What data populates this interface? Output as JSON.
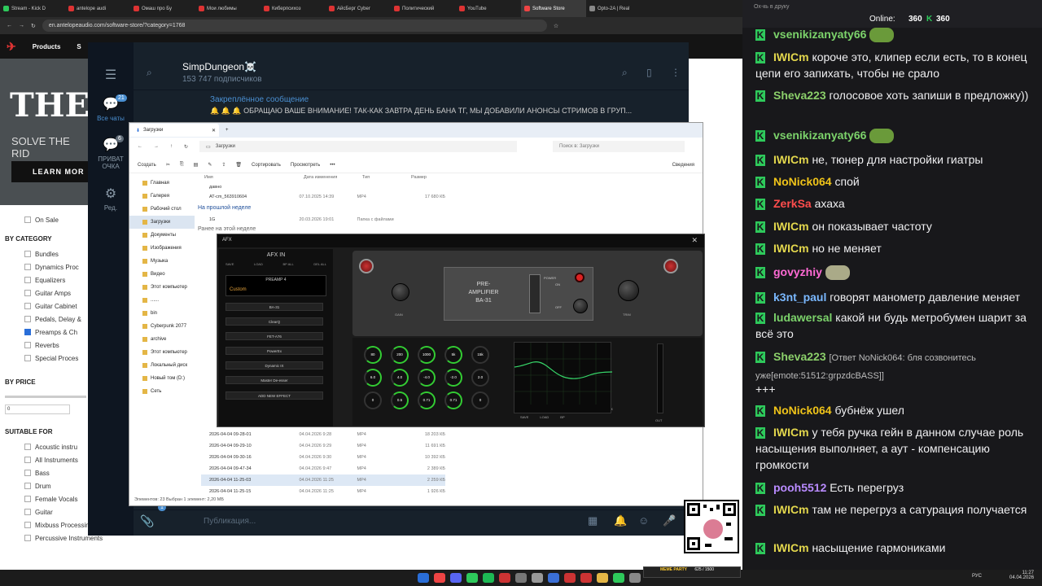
{
  "browser": {
    "tabs": [
      "Stream - Kick D",
      "antelope audi",
      "Омаш про Бу",
      "Мои любимы",
      "Киберпсихоз",
      "АйсБерг Cyber",
      "Политический",
      "YouTube",
      "Software Store",
      "Opto-2A | Real"
    ],
    "url": "en.antelopeaudio.com/software-store/?category=1768",
    "site_nav": [
      "Products",
      "S"
    ],
    "hero_title": "THE",
    "hero_sub": "SOLVE THE RID",
    "hero_btn": "LEARN MOR",
    "filters": {
      "on_sale": "On Sale",
      "by_category": "BY CATEGORY",
      "categories": [
        "Bundles",
        "Dynamics Proc",
        "Equalizers",
        "Guitar Amps",
        "Guitar Cabinet",
        "Pedals, Delay &",
        "Preamps & Ch",
        "Reverbs",
        "Special Proces"
      ],
      "checked_category": "Preamps & Ch",
      "by_price": "BY PRICE",
      "price_min": "0",
      "suitable_for": "SUITABLE FOR",
      "suitable": [
        "Acoustic instru",
        "All Instruments",
        "Bass",
        "Drum",
        "Female Vocals",
        "Guitar",
        "Mixbuss Processing",
        "Percussive Instruments"
      ]
    }
  },
  "telegram": {
    "channel": "SimpDungeon☠️",
    "subscribers": "153 747 подписчиков",
    "nav": [
      {
        "label": "Все чаты",
        "badge": "21",
        "icon": "chat-icon"
      },
      {
        "label": "ПРИВАТ ОЧКА",
        "badge": "6",
        "icon": "chat-icon"
      },
      {
        "label": "Ред.",
        "badge": "",
        "icon": "edit-icon"
      }
    ],
    "pinned_title": "Закреплённое сообщение",
    "pinned_text": "🔔 🔔 🔔 ОБРАЩАЮ ВАШЕ ВНИМАНИЕ!  ТАК-КАК ЗАВТРА ДЕНЬ БАНА ТГ, МЫ ДОБАВИЛИ АНОНСЫ СТРИМОВ В ГРУП...",
    "compose_placeholder": "Публикация...",
    "bottom_badge": "1"
  },
  "explorer": {
    "tab": "Загрузки",
    "path": "Загрузки",
    "search": "Поиск в: Загрузки",
    "toolbar": [
      "Создать",
      "Сортировать",
      "Просмотреть",
      "•••",
      "Сведения"
    ],
    "sidebar": [
      "Главная",
      "Галерея",
      "Рабочий стол",
      "Загрузки",
      "Документы",
      "Изображения",
      "Музыка",
      "Видео",
      "Этот компьютер",
      "......",
      "bin",
      "Cyberpunk 2077",
      "archive",
      "Этот компьютер",
      "Локальный диск",
      "Новый том (D:)",
      "Сеть"
    ],
    "columns": [
      "Имя",
      "Дата изменения",
      "Тип",
      "Размер"
    ],
    "groups": [
      "На прошлой неделе",
      "Ранее на этой неделе"
    ],
    "top_rows": [
      {
        "name": "давно",
        "date": "",
        "type": "",
        "size": ""
      },
      {
        "name": "AT-cm_563910604",
        "date": "07.10.2025 14:39",
        "type": "MP4",
        "size": "17 680 КБ"
      },
      {
        "name": "1G",
        "date": "20.03.2026 19:01",
        "type": "Папка с файлами",
        "size": ""
      }
    ],
    "rows": [
      {
        "name": "2026-04-04 09-28-01",
        "date": "04.04.2026 9:28",
        "type": "MP4",
        "size": "18 203 КБ"
      },
      {
        "name": "2026-04-04 09-29-10",
        "date": "04.04.2026 9:29",
        "type": "MP4",
        "size": "11 691 КБ"
      },
      {
        "name": "2026-04-04 09-30-16",
        "date": "04.04.2026 9:30",
        "type": "MP4",
        "size": "10 392 КБ"
      },
      {
        "name": "2026-04-04 09-47-34",
        "date": "04.04.2026 9:47",
        "type": "MP4",
        "size": "2 389 КБ"
      },
      {
        "name": "2026-04-04 11-25-03",
        "date": "04.04.2026 11:25",
        "type": "MP4",
        "size": "2 259 КБ"
      },
      {
        "name": "2026-04-04 11-25-15",
        "date": "04.04.2026 11:25",
        "type": "MP4",
        "size": "1 926 КБ"
      }
    ],
    "status": "Элементов: 23     Выбран 1 элемент: 2,20 МБ"
  },
  "afx": {
    "title": "AFX",
    "afx_in": "AFX IN",
    "buttons": [
      "SAVE",
      "LOAD",
      "BP ALL",
      "DEL ALL"
    ],
    "preamp_title": "PREAMP 4",
    "preset": "Custom",
    "slots": [
      "BA-31",
      "ClearQ",
      "FET-A76",
      "PowerEx",
      "Dynamic IX",
      "Master De-esser"
    ],
    "add_effect": "ADD NEW EFFECT",
    "unit_title": "PRE-\nAMPLIFIER\nBA-31",
    "unit_line1": "PRE-",
    "unit_line2": "AMPLIFIER",
    "unit_line3": "BA-31",
    "gain": "GAIN",
    "trim": "TRIM",
    "power": "POWER",
    "on": "ON",
    "off": "OFF",
    "eq_row1": [
      "80",
      "200",
      "1000",
      "5k",
      "15k"
    ],
    "eq_row2": [
      "6.0",
      "4.0",
      "-4.0",
      "-2.0",
      "2.0"
    ],
    "eq_row3": [
      "0",
      "0.5",
      "0.71",
      "0.71",
      "0"
    ],
    "graph_labels": [
      "20",
      "50",
      "100",
      "200",
      "500",
      "1K",
      "2K",
      "5K",
      "10K",
      "20K"
    ],
    "graph_buttons": [
      "SAVE",
      "LOAD",
      "BP"
    ],
    "out": "OUT"
  },
  "chat": {
    "online_label": "Online:",
    "online": "360",
    "viewers": "360",
    "placeholder": "Ох-кь в друку",
    "messages": [
      {
        "user": "vsenikizanyaty66",
        "color": "#7cd36b",
        "text": "",
        "emote": true
      },
      {
        "user": "IWICm",
        "color": "#e3d74d",
        "text": "короче это, клипер если есть, то в конец цепи его запихать, чтобы не срало"
      },
      {
        "user": "Sheva223",
        "color": "#8bcf6a",
        "text": "голосовое хоть запиши в предложку))"
      },
      {
        "user": "vsenikizanyaty66",
        "color": "#7cd36b",
        "text": "",
        "emote": true
      },
      {
        "user": "IWICm",
        "color": "#e3d74d",
        "text": "не, тюнер для настройки гиатры"
      },
      {
        "user": "NoNick064",
        "color": "#f0c419",
        "text": "спой"
      },
      {
        "user": "ZerkSa",
        "color": "#ff4d4d",
        "text": "ахаха"
      },
      {
        "user": "IWICm",
        "color": "#e3d74d",
        "text": "он показывает частоту"
      },
      {
        "user": "IWICm",
        "color": "#e3d74d",
        "text": "но не меняет"
      },
      {
        "user": "govyzhiy",
        "color": "#ff6ad5",
        "text": "",
        "emote": true
      },
      {
        "user": "k3nt_paul",
        "color": "#7ab8ff",
        "text": "говорят манометр давление меняет"
      },
      {
        "user": "ludawersal",
        "color": "#7cd36b",
        "text": "какой ни будь метробумен шарит за всё это"
      },
      {
        "user": "Sheva223",
        "color": "#8bcf6a",
        "text": "[Ответ NoNick064: бля созвонитесь уже[emote:51512:grpzdcBASS]]"
      },
      {
        "user": "",
        "color": "#efeff1",
        "text": "+++"
      },
      {
        "user": "NoNick064",
        "color": "#f0c419",
        "text": "бубнёж ушел"
      },
      {
        "user": "IWICm",
        "color": "#e3d74d",
        "text": "у тебя ручка гейн в данном случае роль насыщения выполняет, а аут - компенсацию громкости"
      },
      {
        "user": "pooh5512",
        "color": "#b98bff",
        "text": "Есть перегруз"
      },
      {
        "user": "IWICm",
        "color": "#e3d74d",
        "text": "там не перегруз а сатурация получается"
      },
      {
        "user": "IWICm",
        "color": "#e3d74d",
        "text": "насыщение гармониками"
      }
    ]
  },
  "taskbar": {
    "lang": "РУС",
    "time": "11:27",
    "date": "04.04.2026",
    "meme": "MEME PARTY",
    "meme_count": "625 / 1500"
  }
}
